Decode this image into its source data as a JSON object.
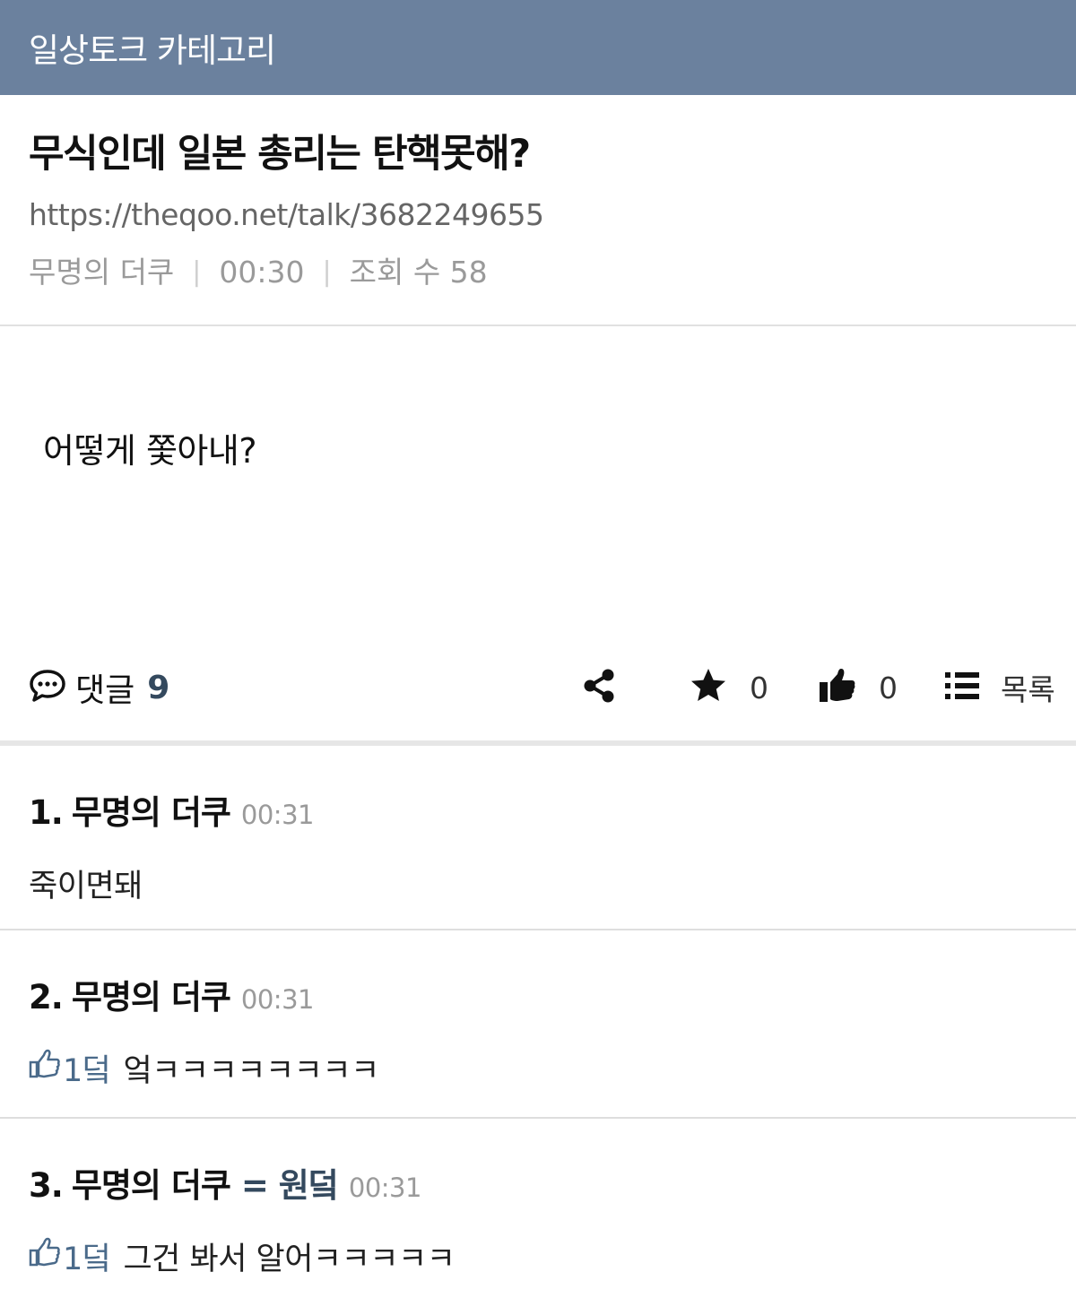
{
  "category_bar": {
    "title": "일상토크 카테고리"
  },
  "post": {
    "title": "무식인데 일본 총리는 탄핵못해?",
    "url": "https://theqoo.net/talk/3682249655",
    "author": "무명의 더쿠",
    "time": "00:30",
    "views": "조회 수 58",
    "body": "어떻게 쫓아내?"
  },
  "actions": {
    "comment_label": "댓글",
    "comment_count": "9",
    "star_count": "0",
    "like_count": "0",
    "list_label": "목록",
    "icons": [
      "speech-bubble-icon",
      "share-icon",
      "star-icon",
      "thumbs-up-icon",
      "list-icon"
    ]
  },
  "comments": [
    {
      "index": "1.",
      "author": "무명의 더쿠",
      "op_tag": "",
      "time": "00:31",
      "likes": "",
      "text": "죽이면돼"
    },
    {
      "index": "2.",
      "author": "무명의 더쿠",
      "op_tag": "",
      "time": "00:31",
      "likes": "1덬",
      "text": "엌ㅋㅋㅋㅋㅋㅋㅋㅋ"
    },
    {
      "index": "3.",
      "author": "무명의 더쿠",
      "op_tag": "= 원덬",
      "time": "00:31",
      "likes": "1덬",
      "text": "그건 봐서 알어ㅋㅋㅋㅋㅋ"
    }
  ],
  "colors": {
    "header_bg": "#6b819e",
    "accent": "#34495e",
    "like": "#4a6a8a",
    "muted": "#9a9a9a"
  }
}
